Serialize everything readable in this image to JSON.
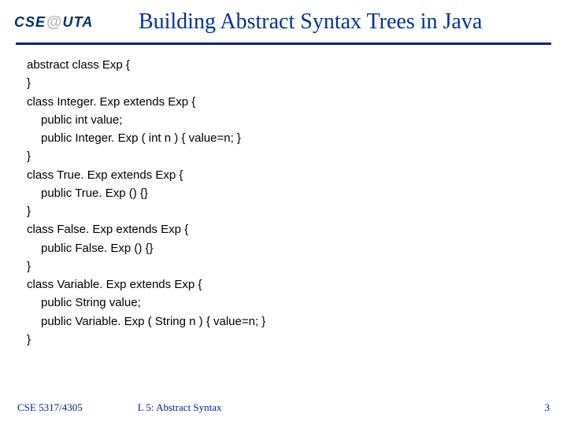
{
  "logo": {
    "left": "CSE",
    "at": "@",
    "right": "UTA"
  },
  "title": "Building Abstract Syntax Trees in Java",
  "code": {
    "l1": "abstract class Exp {",
    "l2": "}",
    "l3": "class Integer. Exp extends Exp {",
    "l4": "public int value;",
    "l5": "public Integer. Exp ( int n ) { value=n; }",
    "l6": "}",
    "l7": "class True. Exp extends Exp {",
    "l8": "public True. Exp () {}",
    "l9": "}",
    "l10": "class False. Exp extends Exp {",
    "l11": "public False. Exp () {}",
    "l12": "}",
    "l13": "class Variable. Exp extends Exp {",
    "l14": "public String value;",
    "l15": "public Variable. Exp ( String n ) { value=n; }",
    "l16": "}"
  },
  "footer": {
    "left": "CSE 5317/4305",
    "mid": "L 5: Abstract Syntax",
    "right": "3"
  }
}
